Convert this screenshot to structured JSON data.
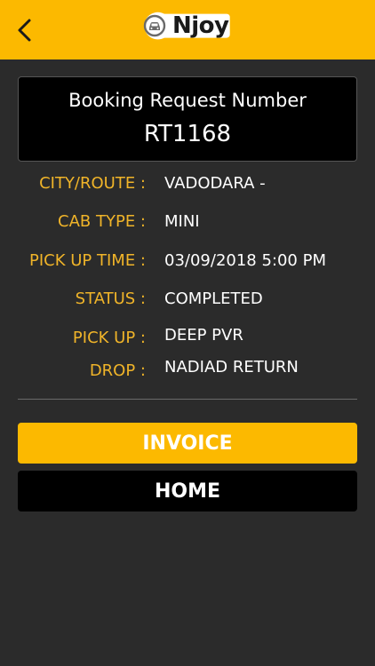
{
  "header": {
    "back_icon": "chevron-left-icon",
    "logo_text": "Njoy",
    "logo_icon": "car-pin-icon",
    "accent_color": "#fcb900"
  },
  "booking": {
    "title": "Booking Request Number",
    "number": "RT1168"
  },
  "details": [
    {
      "label": "CITY/ROUTE :",
      "value": "VADODARA -"
    },
    {
      "label": "CAB TYPE :",
      "value": "MINI"
    },
    {
      "label": "PICK UP TIME :",
      "value": "03/09/2018 5:00 PM"
    },
    {
      "label": "STATUS :",
      "value": "COMPLETED"
    },
    {
      "label": "PICK UP :",
      "value": "DEEP PVR"
    },
    {
      "label": "DROP :",
      "value": "NADIAD RETURN"
    }
  ],
  "buttons": {
    "invoice": "INVOICE",
    "home": "HOME"
  }
}
